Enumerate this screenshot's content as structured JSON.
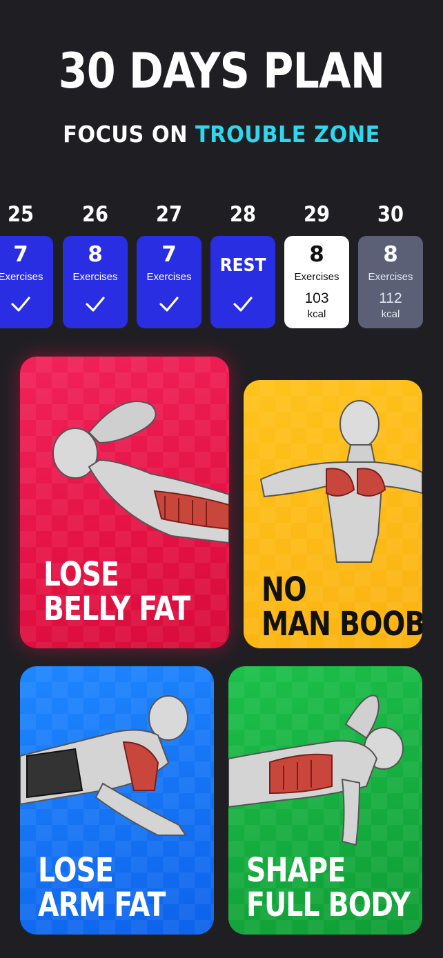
{
  "header": {
    "title": "30 DAYS PLAN",
    "subtitle_prefix": "FOCUS ON ",
    "subtitle_accent": "TROUBLE ZONE",
    "accent_color": "#2ed7ee"
  },
  "days": [
    {
      "day": "25",
      "status": "done",
      "count": "7",
      "unit": "Exercises",
      "icon": "check-icon"
    },
    {
      "day": "26",
      "status": "done",
      "count": "8",
      "unit": "Exercises",
      "icon": "check-icon"
    },
    {
      "day": "27",
      "status": "done",
      "count": "7",
      "unit": "Exercises",
      "icon": "check-icon"
    },
    {
      "day": "28",
      "status": "done",
      "label": "REST",
      "icon": "check-icon"
    },
    {
      "day": "29",
      "status": "today",
      "count": "8",
      "unit": "Exercises",
      "kcal": "103",
      "kcal_unit": "kcal"
    },
    {
      "day": "30",
      "status": "future",
      "count": "8",
      "unit": "Exercises",
      "kcal": "112",
      "kcal_unit": "kcal"
    }
  ],
  "tiles": [
    {
      "line1": "LOSE",
      "line2": "BELLY FAT",
      "color": "#e41244"
    },
    {
      "line1": "NO",
      "line2": "MAN BOOBS",
      "color": "#fbb311"
    },
    {
      "line1": "LOSE",
      "line2": "ARM FAT",
      "color": "#0d62ea"
    },
    {
      "line1": "SHAPE",
      "line2": "FULL BODY",
      "color": "#0f9d35"
    }
  ],
  "colors": {
    "background": "#1f1f23",
    "done_card": "#2a2ee3",
    "today_card": "#ffffff",
    "future_card": "#5b6076"
  }
}
